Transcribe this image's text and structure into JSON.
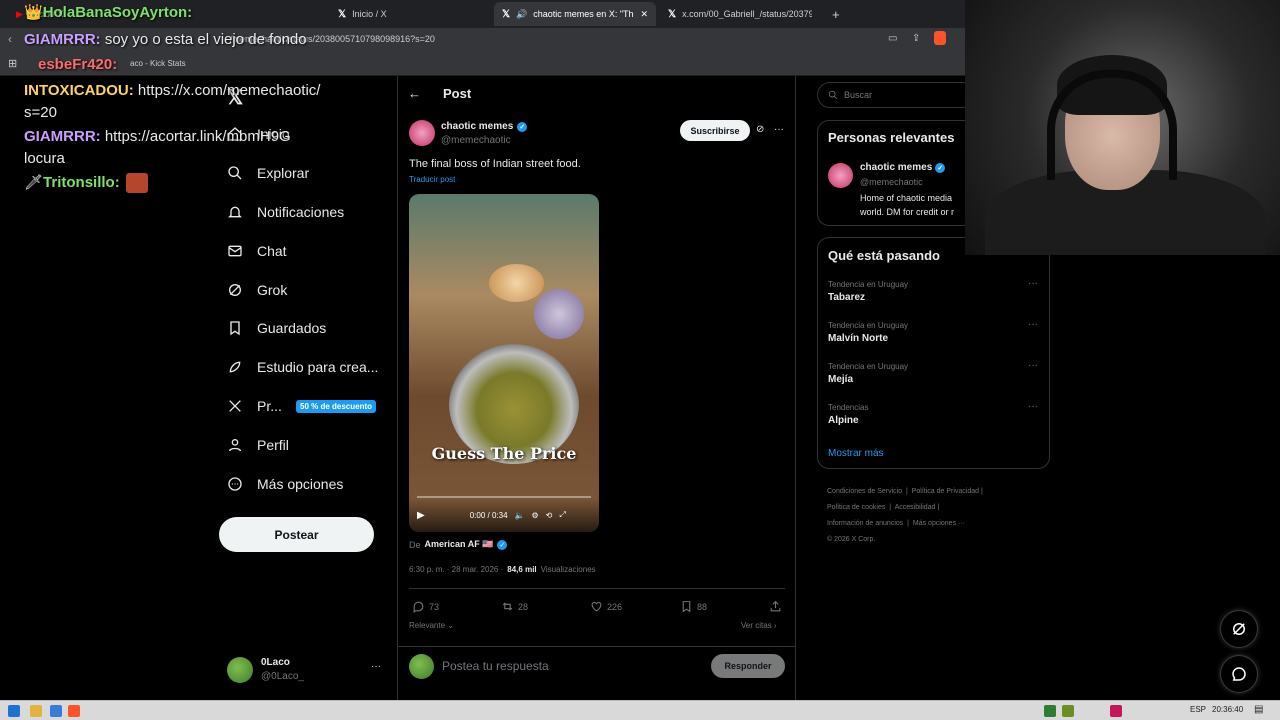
{
  "browser": {
    "tabs": [
      {
        "label": "Inicio / X",
        "active": false
      },
      {
        "label": "Inicio / X",
        "active": false
      },
      {
        "label": "chaotic memes en X: \"The fi",
        "active": true
      },
      {
        "label": "x.com/00_Gabriell_/status/2037947",
        "active": false
      }
    ],
    "new_tab": "+",
    "url": "/memechaotic/status/2038005710798098916?s=20",
    "bookmark": "aco - Kick Stats"
  },
  "chat_overlay": {
    "lines": [
      {
        "user": "HolaBanaSoyAyrton:",
        "text": "",
        "color": "#7ee06a"
      },
      {
        "user": "GIAMRRR:",
        "text": " soy yo o esta el viejo de fondo",
        "color": "#c9a0ff"
      },
      {
        "user": "esbeFr420:",
        "text": "",
        "color": "#ff6b6b"
      },
      {
        "user": "INTOXICADOU:",
        "text": " https://x.com/memechaotic/",
        "color": "#ffd166"
      },
      {
        "user": "",
        "text": "s=20",
        "color": "#ffffff"
      },
      {
        "user": "GIAMRRR:",
        "text": " https://acortar.link/mbmH9G",
        "color": "#c9a0ff"
      },
      {
        "user": "",
        "text": "locura",
        "color": "#ffffff"
      },
      {
        "user": "Tritonsillo:",
        "text": "",
        "color": "#7ee06a"
      }
    ]
  },
  "sidebar": {
    "items": [
      {
        "label": "Inicio",
        "icon": "home-icon"
      },
      {
        "label": "Explorar",
        "icon": "search-icon"
      },
      {
        "label": "Notificaciones",
        "icon": "bell-icon"
      },
      {
        "label": "Chat",
        "icon": "mail-icon"
      },
      {
        "label": "Grok",
        "icon": "grok-icon"
      },
      {
        "label": "Guardados",
        "icon": "bookmark-icon"
      },
      {
        "label": "Estudio para crea...",
        "icon": "rocket-icon"
      },
      {
        "label": "Pr...",
        "icon": "x-logo-icon"
      },
      {
        "label": "Perfil",
        "icon": "person-icon"
      },
      {
        "label": "Más opciones",
        "icon": "more-circle-icon"
      }
    ],
    "promo_badge": "50 % de descuento",
    "post_button": "Postear",
    "profile": {
      "name": "0Laco",
      "handle": "@0Laco_",
      "more": "···"
    }
  },
  "post": {
    "header_title": "Post",
    "author_name": "chaotic memes",
    "author_handle": "@memechaotic",
    "subscribe_label": "Suscribirse",
    "more": "···",
    "text": "The final boss of Indian street food.",
    "translate": "Traducir post",
    "media": {
      "caption": "Guess The Price",
      "time": "0:00 / 0:34",
      "progress": 0
    },
    "source_prefix": "De",
    "source_name": "American AF 🇺🇸",
    "timestamp": "6:30 p. m. · 28 mar. 2026 ·",
    "views_count": "84,6 mil",
    "views_label": "Visualizaciones",
    "actions": {
      "replies": "73",
      "reposts": "28",
      "likes": "226",
      "bookmarks": "88"
    },
    "sort_label": "Relevante",
    "quotes_label": "Ver citas",
    "reply_placeholder": "Postea tu respuesta",
    "reply_button": "Responder"
  },
  "right": {
    "search_placeholder": "Buscar",
    "relevant": {
      "title": "Personas relevantes",
      "name": "chaotic memes",
      "handle": "@memechaotic",
      "bio_1": "Home of chaotic media",
      "bio_2": "world. DM for credit or r"
    },
    "trends": {
      "title": "Qué está pasando",
      "items": [
        {
          "context": "Tendencia en Uruguay",
          "name": "Tabarez"
        },
        {
          "context": "Tendencia en Uruguay",
          "name": "Malvín Norte"
        },
        {
          "context": "Tendencia en Uruguay",
          "name": "Mejía"
        },
        {
          "context": "Tendencias",
          "name": "Alpine"
        }
      ],
      "more": "···",
      "show_more": "Mostrar más"
    },
    "footer": [
      "Condiciones de Servicio",
      "Política de Privacidad",
      "Política de cookies",
      "Accesibilidad",
      "Información de anuncios",
      "Más opciones ···",
      "© 2026 X Corp."
    ]
  },
  "taskbar": {
    "lang": "ESP",
    "time": "20:36:40"
  },
  "colors": {
    "accent": "#1d9bf0",
    "text": "#e7e9ea",
    "muted": "#71767b",
    "border": "#2f3336"
  }
}
